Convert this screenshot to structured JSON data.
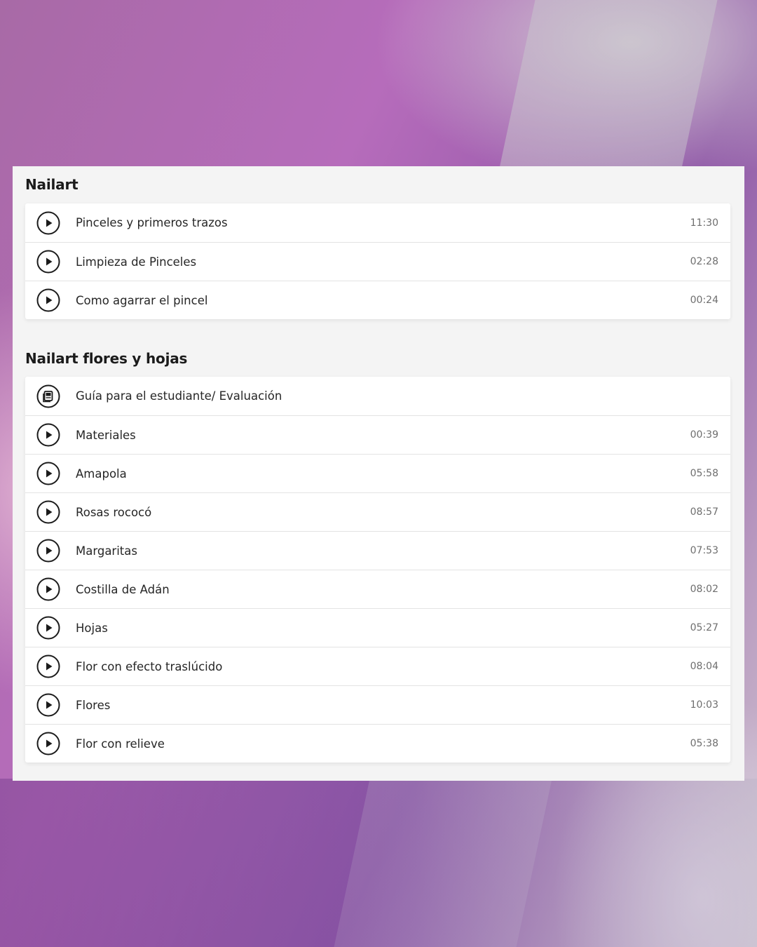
{
  "sections": [
    {
      "title": "Nailart",
      "lessons": [
        {
          "label": "Pinceles y primeros trazos",
          "duration": "11:30",
          "icon": "play-icon"
        },
        {
          "label": "Limpieza de Pinceles",
          "duration": "02:28",
          "icon": "play-icon"
        },
        {
          "label": "Como agarrar el pincel",
          "duration": "00:24",
          "icon": "play-icon"
        }
      ]
    },
    {
      "title": "Nailart flores y hojas",
      "lessons": [
        {
          "label": "Guía para el estudiante/ Evaluación",
          "duration": "",
          "icon": "document-icon"
        },
        {
          "label": "Materiales",
          "duration": "00:39",
          "icon": "play-icon"
        },
        {
          "label": "Amapola",
          "duration": "05:58",
          "icon": "play-icon"
        },
        {
          "label": "Rosas rococó",
          "duration": "08:57",
          "icon": "play-icon"
        },
        {
          "label": "Margaritas",
          "duration": "07:53",
          "icon": "play-icon"
        },
        {
          "label": "Costilla de Adán",
          "duration": "08:02",
          "icon": "play-icon"
        },
        {
          "label": "Hojas",
          "duration": "05:27",
          "icon": "play-icon"
        },
        {
          "label": "Flor con efecto traslúcido",
          "duration": "08:04",
          "icon": "play-icon"
        },
        {
          "label": "Flores",
          "duration": "10:03",
          "icon": "play-icon"
        },
        {
          "label": "Flor con relieve",
          "duration": "05:38",
          "icon": "play-icon"
        }
      ]
    }
  ]
}
